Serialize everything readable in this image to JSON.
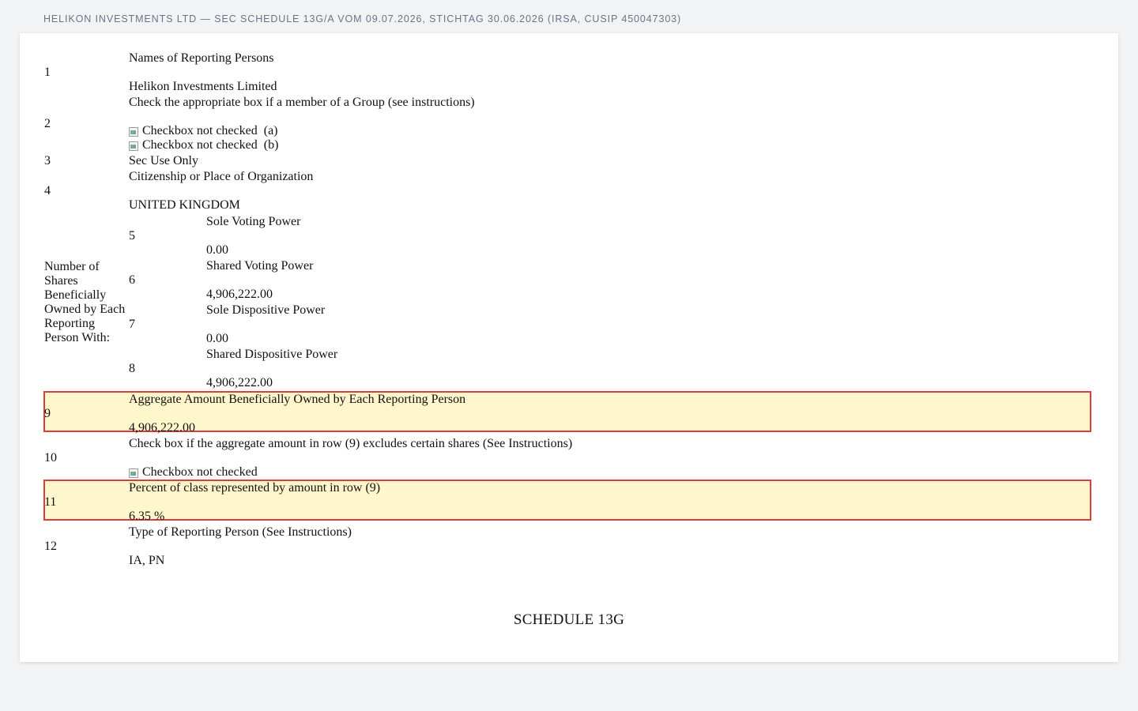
{
  "header": {
    "title": "HELIKON INVESTMENTS LTD — SEC SCHEDULE 13G/A VOM 09.07.2026, STICHTAG 30.06.2026 (IRSA, CUSIP 450047303)"
  },
  "rows": {
    "r1": {
      "num": "1",
      "label": "Names of Reporting Persons",
      "value": "Helikon Investments Limited"
    },
    "r2": {
      "num": "2",
      "label": "Check the appropriate box if a member of a Group (see instructions)",
      "opt_a": "(a)",
      "opt_b": "(b)"
    },
    "r3": {
      "num": "3",
      "label": "Sec Use Only"
    },
    "r4": {
      "num": "4",
      "label": "Citizenship or Place of Organization",
      "value": "UNITED KINGDOM"
    },
    "shares_label": "Number of Shares Beneficially Owned by Each Reporting Person With:",
    "r5": {
      "num": "5",
      "label": "Sole Voting Power",
      "value": "0.00"
    },
    "r6": {
      "num": "6",
      "label": "Shared Voting Power",
      "value": "4,906,222.00"
    },
    "r7": {
      "num": "7",
      "label": "Sole Dispositive Power",
      "value": "0.00"
    },
    "r8": {
      "num": "8",
      "label": "Shared Dispositive Power",
      "value": "4,906,222.00"
    },
    "r9": {
      "num": "9",
      "label": "Aggregate Amount Beneficially Owned by Each Reporting Person",
      "value": "4,906,222.00"
    },
    "r10": {
      "num": "10",
      "label": "Check box if the aggregate amount in row (9) excludes certain shares (See Instructions)"
    },
    "r11": {
      "num": "11",
      "label": "Percent of class represented by amount in row (9)",
      "value": "6.35 %"
    },
    "r12": {
      "num": "12",
      "label": "Type of Reporting Person (See Instructions)",
      "value": "IA, PN"
    }
  },
  "checkbox_alt": "Checkbox not checked",
  "footer": {
    "title": "SCHEDULE 13G"
  }
}
